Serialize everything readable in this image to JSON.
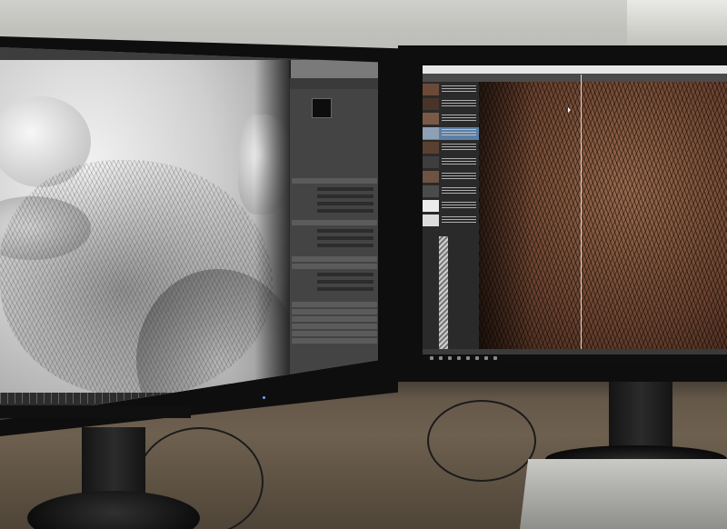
{
  "scene": {
    "description_tag": "photo-of-two-monitors",
    "colors": {
      "timeline_range": "#c9413a",
      "selection": "#5b7fa6",
      "power_led": "#6fa8ff"
    }
  },
  "left_monitor": {
    "panel_icons": [
      "material-swatch-icon",
      "slider-icon"
    ]
  },
  "right_monitor": {
    "icons": [
      "thumbnail-icon",
      "cursor-icon"
    ]
  }
}
